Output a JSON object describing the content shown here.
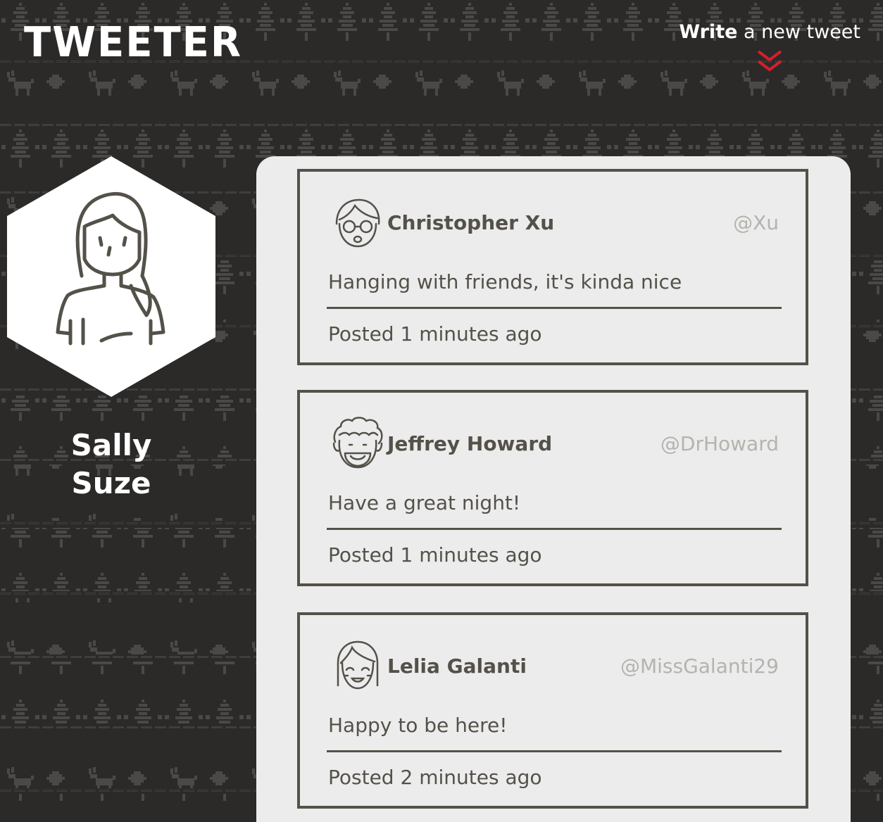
{
  "header": {
    "logo": "TWEETER",
    "compose_strong": "Write",
    "compose_rest": " a new tweet",
    "compose_icon": "double-chevron-down-icon",
    "accent_color": "#d4202a"
  },
  "profile": {
    "name_line1": "Sally",
    "name_line2": "Suze",
    "avatar_icon": "woman-avatar-icon"
  },
  "colors": {
    "background": "#2b2a29",
    "panel": "#ececec",
    "text": "#545149",
    "handle": "#b5b3ae"
  },
  "tweets": [
    {
      "author": "Christopher Xu",
      "handle": "@Xu",
      "body": "Hanging with friends, it's kinda nice",
      "posted": "Posted 1 minutes ago",
      "avatar_icon": "man-with-glasses-avatar-icon"
    },
    {
      "author": "Jeffrey Howard",
      "handle": "@DrHoward",
      "body": "Have a great night!",
      "posted": "Posted 1 minutes ago",
      "avatar_icon": "curly-hair-man-avatar-icon"
    },
    {
      "author": "Lelia Galanti",
      "handle": "@MissGalanti29",
      "body": "Happy to be here!",
      "posted": "Posted 2 minutes ago",
      "avatar_icon": "girl-bangs-avatar-icon"
    }
  ]
}
